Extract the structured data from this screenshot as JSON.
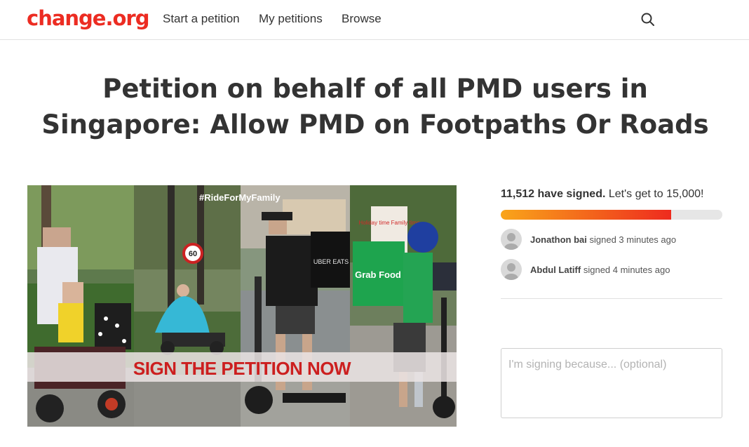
{
  "header": {
    "logo": "change.org",
    "nav": [
      "Start a petition",
      "My petitions",
      "Browse"
    ]
  },
  "petition": {
    "title": "Petition on behalf of all PMD users in Singapore: Allow PMD on Footpaths Or Roads"
  },
  "hero": {
    "hashtag": "#RideForMyFamily",
    "banner": "SIGN THE PETITION NOW",
    "sign_60": "60",
    "bag_uber": "UBER EATS",
    "bag_grab": "Grab Food",
    "poster": "Holiday time Family time"
  },
  "progress": {
    "signed_count": "11,512 have signed.",
    "goal_text": "Let's get to 15,000!",
    "fraction": 0.7675
  },
  "recent_signers": [
    {
      "name": "Jonathon bai",
      "action": "signed 3 minutes ago"
    },
    {
      "name": "Abdul Latiff",
      "action": "signed 4 minutes ago"
    }
  ],
  "reason_input": {
    "placeholder": "I'm signing because... (optional)",
    "value": ""
  },
  "colors": {
    "brand": "#ec2c22",
    "progress_start": "#f9a51a",
    "progress_end": "#ee2b1e"
  }
}
